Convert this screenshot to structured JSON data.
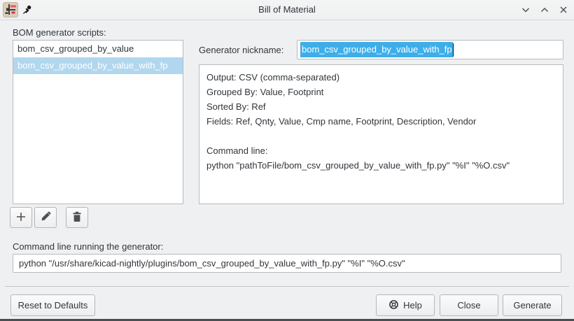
{
  "window": {
    "title": "Bill of Material"
  },
  "scripts_panel": {
    "label": "BOM generator scripts:",
    "items": [
      {
        "label": "bom_csv_grouped_by_value",
        "selected": false
      },
      {
        "label": "bom_csv_grouped_by_value_with_fp",
        "selected": true
      }
    ]
  },
  "nickname": {
    "label": "Generator nickname:",
    "value": "bom_csv_grouped_by_value_with_fp"
  },
  "info_panel": {
    "lines": [
      "Output: CSV (comma-separated)",
      "Grouped By: Value, Footprint",
      "Sorted By: Ref",
      "Fields: Ref, Qnty, Value, Cmp name, Footprint, Description, Vendor",
      "",
      "Command line:",
      "python \"pathToFile/bom_csv_grouped_by_value_with_fp.py\" \"%I\" \"%O.csv\""
    ]
  },
  "command_line": {
    "label": "Command line running the generator:",
    "value": "python \"/usr/share/kicad-nightly/plugins/bom_csv_grouped_by_value_with_fp.py\" \"%I\" \"%O.csv\""
  },
  "buttons": {
    "reset": "Reset to Defaults",
    "help": "Help",
    "close": "Close",
    "generate": "Generate"
  },
  "colors": {
    "highlight": "#3daee9",
    "list_selection": "#b1d7ee",
    "window_bg": "#eff0f1"
  }
}
